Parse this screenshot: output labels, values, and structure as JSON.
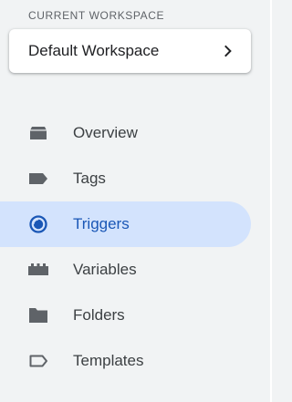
{
  "workspace": {
    "section_label": "CURRENT WORKSPACE",
    "name": "Default Workspace",
    "chevron_icon": "chevron-right-icon"
  },
  "nav": {
    "items": [
      {
        "label": "Overview",
        "icon": "overview-icon",
        "active": false
      },
      {
        "label": "Tags",
        "icon": "tag-icon",
        "active": false
      },
      {
        "label": "Triggers",
        "icon": "trigger-icon",
        "active": true
      },
      {
        "label": "Variables",
        "icon": "variables-icon",
        "active": false
      },
      {
        "label": "Folders",
        "icon": "folder-icon",
        "active": false
      },
      {
        "label": "Templates",
        "icon": "template-icon",
        "active": false
      }
    ]
  },
  "colors": {
    "background": "#f1f3f4",
    "active_background": "#d3e3fd",
    "active_text": "#1a57b6",
    "icon_gray": "#5f6368",
    "text": "#3c4043"
  }
}
